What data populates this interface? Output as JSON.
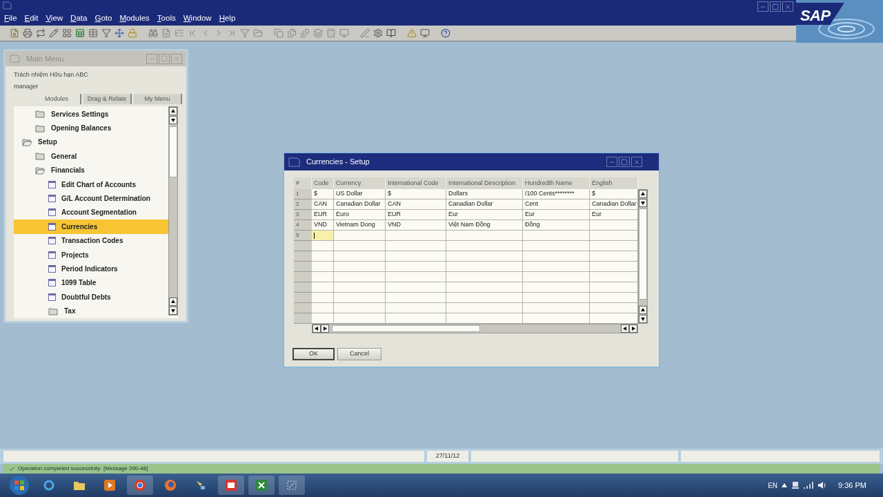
{
  "app": {
    "menu": [
      "File",
      "Edit",
      "View",
      "Data",
      "Goto",
      "Modules",
      "Tools",
      "Window",
      "Help"
    ],
    "logo": "SAP"
  },
  "main_menu": {
    "title": "Main Menu",
    "company": "Trách nhiệm Hữu hạn ABC",
    "user": "manager",
    "tabs": [
      {
        "label": "Modules",
        "selected": true
      },
      {
        "label": "Drag & Relate",
        "selected": false
      },
      {
        "label": "My Menu",
        "selected": false
      }
    ],
    "tree": [
      {
        "children": [
          {
            "label": "Services Settings",
            "kind": "folder",
            "expanded": false,
            "selected": false
          },
          {
            "label": "Opening Balances",
            "kind": "folder",
            "expanded": false,
            "selected": false
          }
        ]
      },
      {
        "label": "Setup",
        "kind": "folder",
        "expanded": true,
        "selected": false,
        "children": [
          {
            "label": "General",
            "kind": "folder",
            "expanded": false,
            "selected": false
          },
          {
            "label": "Financials",
            "kind": "folder",
            "expanded": true,
            "selected": false,
            "children": [
              {
                "label": "Edit Chart of Accounts",
                "kind": "form",
                "selected": false
              },
              {
                "label": "G/L Account Determination",
                "kind": "form",
                "selected": false
              },
              {
                "label": "Account Segmentation",
                "kind": "form",
                "selected": false
              },
              {
                "label": "Currencies",
                "kind": "form",
                "selected": true
              },
              {
                "label": "Transaction Codes",
                "kind": "form",
                "selected": false
              },
              {
                "label": "Projects",
                "kind": "form",
                "selected": false
              },
              {
                "label": "Period Indicators",
                "kind": "form",
                "selected": false
              },
              {
                "label": "1099 Table",
                "kind": "form",
                "selected": false
              },
              {
                "label": "Doubtful Debts",
                "kind": "form",
                "selected": false
              },
              {
                "label": "Tax",
                "kind": "folder",
                "expanded": false,
                "selected": false
              }
            ]
          }
        ]
      }
    ]
  },
  "currencies_window": {
    "title": "Currencies - Setup",
    "table": {
      "columns": [
        "#",
        "Code",
        "Currency",
        "International Code",
        "International Description",
        "Hundredth Name",
        "English"
      ],
      "rows": [
        {
          "cells": [
            "1",
            "$",
            "US Dollar",
            "$",
            "Dollars",
            "/100 Cents********",
            "$"
          ],
          "active": false
        },
        {
          "cells": [
            "2",
            "CAN",
            "Canadian Dollar",
            "CAN",
            "Canadian Dollar",
            "Cent",
            "Canadian Dollar"
          ],
          "active": false
        },
        {
          "cells": [
            "3",
            "EUR",
            "Euro",
            "EUR",
            "Eur",
            "Eur",
            "Eur"
          ],
          "active": false
        },
        {
          "cells": [
            "4",
            "VND",
            "Vietnam Dong",
            "VND",
            "Việt Nam Đồng",
            "Đồng"
          ],
          "active": false
        },
        {
          "cells": [
            "5"
          ],
          "active": true
        }
      ]
    },
    "buttons": [
      "OK",
      "Cancel"
    ]
  },
  "status_bar": {
    "date": "27/11/12",
    "message": "Operation completed successfully  [Message 200-48]"
  },
  "taskbar": {
    "language": "EN",
    "time": "9:36 PM"
  }
}
